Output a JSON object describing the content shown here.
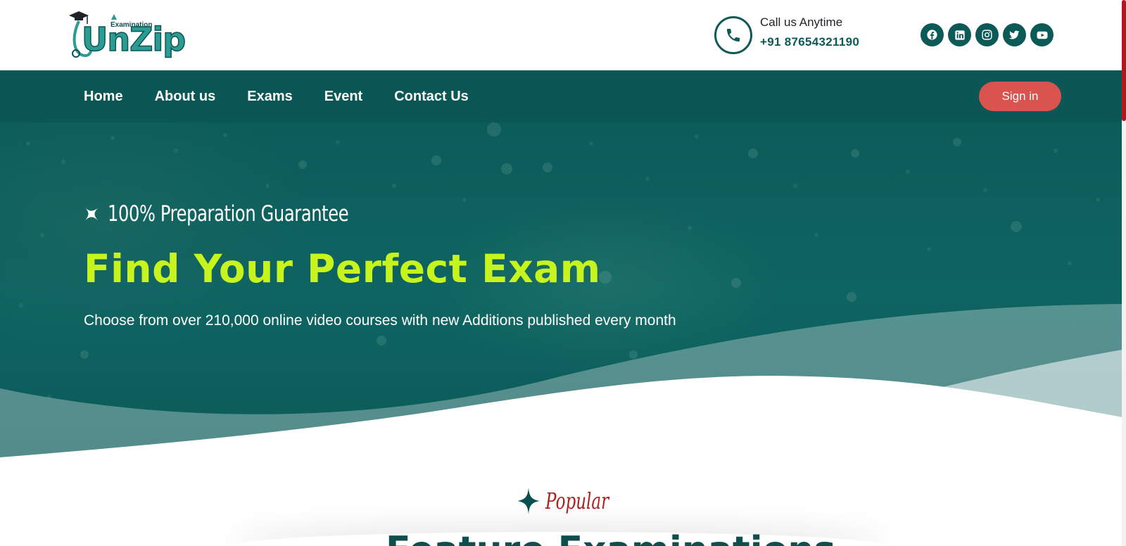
{
  "brand": {
    "name": "UnZip",
    "tag": "Examination"
  },
  "contact": {
    "label": "Call us Anytime",
    "phone": "+91 87654321190",
    "icon": "phone-icon"
  },
  "socials": [
    {
      "name": "facebook-icon"
    },
    {
      "name": "linkedin-icon"
    },
    {
      "name": "instagram-icon"
    },
    {
      "name": "twitter-icon"
    },
    {
      "name": "youtube-icon"
    }
  ],
  "nav": {
    "links": [
      "Home",
      "About us",
      "Exams",
      "Event",
      "Contact Us"
    ],
    "signin": "Sign in"
  },
  "hero": {
    "kicker": "100% Preparation Guarantee",
    "title": "Find Your Perfect Exam",
    "subtitle": "Choose from over 210,000 online video courses with new Additions published every month"
  },
  "section": {
    "label": "Popular",
    "title": "Feature Examinations"
  },
  "colors": {
    "primary": "#0a5755",
    "accent_lime": "#c7f41d",
    "signin_bg": "#d9534f",
    "popular_red": "#b01e1e"
  }
}
